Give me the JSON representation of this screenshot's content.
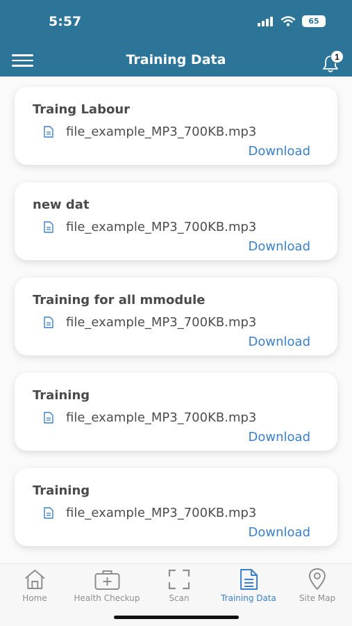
{
  "status_bar": {
    "time": "5:57",
    "battery": "65"
  },
  "header": {
    "title": "Training Data",
    "notification_count": "1"
  },
  "cards": [
    {
      "title": "Traing Labour",
      "file": "file_example_MP3_700KB.mp3",
      "action": "Download"
    },
    {
      "title": "new dat",
      "file": "file_example_MP3_700KB.mp3",
      "action": "Download"
    },
    {
      "title": "Training for all mmodule",
      "file": "file_example_MP3_700KB.mp3",
      "action": "Download"
    },
    {
      "title": "Training",
      "file": "file_example_MP3_700KB.mp3",
      "action": "Download"
    },
    {
      "title": "Training",
      "file": "file_example_MP3_700KB.mp3",
      "action": "Download"
    }
  ],
  "tabs": [
    {
      "label": "Home",
      "icon": "home-icon"
    },
    {
      "label": "Health Checkup",
      "icon": "medical-kit-icon"
    },
    {
      "label": "Scan",
      "icon": "scan-icon"
    },
    {
      "label": "Training Data",
      "icon": "document-icon",
      "active": true
    },
    {
      "label": "Site Map",
      "icon": "map-pin-icon"
    }
  ],
  "colors": {
    "header": "#2d7499",
    "accent": "#3a80c9",
    "text": "#4a4a4a"
  }
}
